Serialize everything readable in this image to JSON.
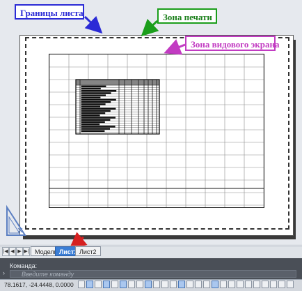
{
  "callouts": {
    "sheet_bounds": "Границы листа",
    "print_zone": "Зона печати",
    "viewport_zone": "Зона видового экрана"
  },
  "tabs": {
    "model": "Модель",
    "sheet1": "Лист1",
    "sheet2": "Лист2"
  },
  "nav_buttons": [
    "|◀",
    "◀",
    "▶",
    "▶|"
  ],
  "command": {
    "history_label": "Команда:",
    "input_placeholder": "Введите команду",
    "prompt_icon": "›"
  },
  "status": {
    "coordinates": "78.1617, -24.4448, 0.0000"
  },
  "colors": {
    "sheet_callout": "#2b2bd6",
    "print_callout": "#1b9e1b",
    "viewport_callout": "#c23bc2",
    "active_tab": "#3b7ed6",
    "arrow_red": "#d62020"
  },
  "icons": [
    "ucs-icon",
    "arrow-icon",
    "status-toggle-icon"
  ]
}
